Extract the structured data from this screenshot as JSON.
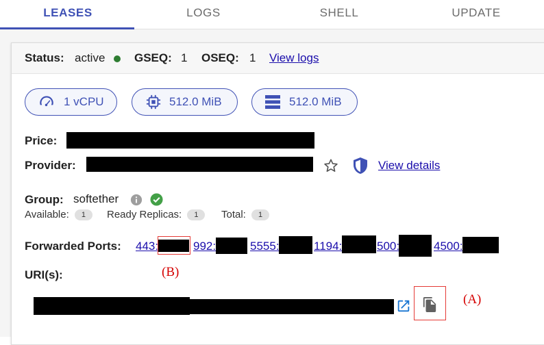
{
  "tabs": [
    {
      "label": "LEASES",
      "active": true
    },
    {
      "label": "LOGS",
      "active": false
    },
    {
      "label": "SHELL",
      "active": false
    },
    {
      "label": "UPDATE",
      "active": false
    }
  ],
  "status": {
    "status_label": "Status:",
    "status_value": "active",
    "gseq_label": "GSEQ:",
    "gseq_value": "1",
    "oseq_label": "OSEQ:",
    "oseq_value": "1",
    "view_logs": "View logs"
  },
  "resources": {
    "cpu": "1 vCPU",
    "memory": "512.0 MiB",
    "storage": "512.0 MiB"
  },
  "price": {
    "label": "Price:"
  },
  "provider": {
    "label": "Provider:",
    "view_details": "View details"
  },
  "group": {
    "label": "Group:",
    "value": "softether",
    "available_label": "Available:",
    "available_value": "1",
    "ready_label": "Ready Replicas:",
    "ready_value": "1",
    "total_label": "Total:",
    "total_value": "1"
  },
  "ports": {
    "label": "Forwarded Ports:",
    "items": [
      "443:",
      "992:",
      "5555:",
      "1194:",
      "500:",
      "4500:"
    ]
  },
  "uris": {
    "label": "URI(s):"
  },
  "annotations": {
    "a": "(A)",
    "b": "(B)"
  },
  "colors": {
    "accent": "#3f51b5",
    "status_active": "#2e7d32",
    "annotation": "#e53935"
  }
}
